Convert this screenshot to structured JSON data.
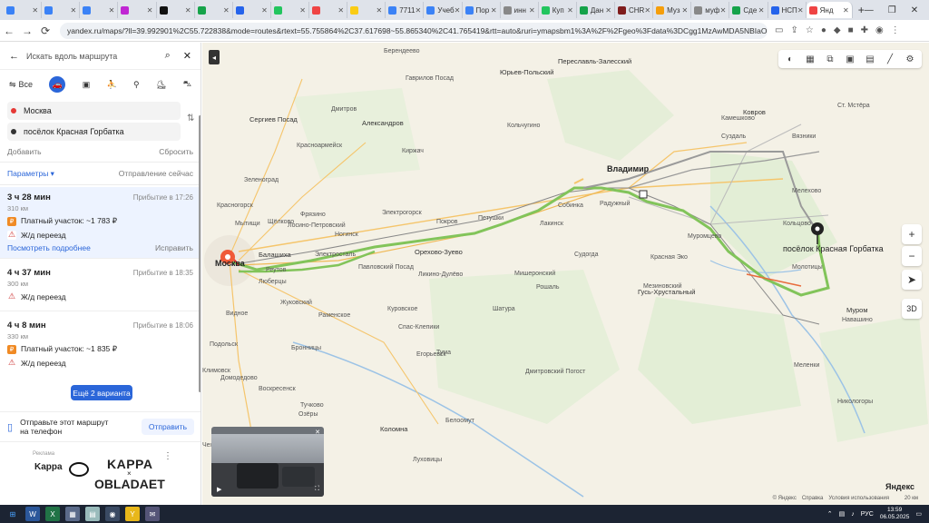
{
  "browser": {
    "tabs": [
      {
        "label": "",
        "color": "#3b82f6"
      },
      {
        "label": "",
        "color": "#3b82f6"
      },
      {
        "label": "",
        "color": "#3b82f6"
      },
      {
        "label": "",
        "color": "#c026d3"
      },
      {
        "label": "",
        "color": "#111111"
      },
      {
        "label": "",
        "color": "#16a34a"
      },
      {
        "label": "",
        "color": "#2563eb"
      },
      {
        "label": "",
        "color": "#22c55e"
      },
      {
        "label": "",
        "color": "#ef4444"
      },
      {
        "label": "",
        "color": "#facc15"
      },
      {
        "label": "7711",
        "color": "#3b82f6"
      },
      {
        "label": "Учеб",
        "color": "#3b82f6"
      },
      {
        "label": "Пор",
        "color": "#3b82f6"
      },
      {
        "label": "инн",
        "color": "#888888"
      },
      {
        "label": "Куп",
        "color": "#22c55e"
      },
      {
        "label": "Дан",
        "color": "#16a34a"
      },
      {
        "label": "CHR",
        "color": "#7f1d1d"
      },
      {
        "label": "Муз",
        "color": "#f59e0b"
      },
      {
        "label": "муф",
        "color": "#888888"
      },
      {
        "label": "Сде",
        "color": "#16a34a"
      },
      {
        "label": "НСП",
        "color": "#2563eb"
      },
      {
        "label": "Янд",
        "color": "#ef4444",
        "active": true
      }
    ],
    "url": "yandex.ru/maps/?ll=39.992901%2C55.722838&mode=routes&rtext=55.755864%2C37.617698~55.865340%2C41.765419&rtt=auto&ruri=ymapsbm1%3A%2F%2Fgeo%3Fdata%3DCgg1MzAwMDA5NBIaOKDQvtGB0YHQuNGPLC..."
  },
  "panel": {
    "search_placeholder": "Искать вдоль маршрута",
    "modes": [
      "Все"
    ],
    "from": "Москва",
    "to": "посёлок Красная Горбатка",
    "add": "Добавить",
    "reset": "Сбросить",
    "params": "Параметры ▾",
    "departure": "Отправление сейчас",
    "routes": [
      {
        "time": "3 ч 28 мин",
        "arrival": "Прибытие в 17:26",
        "distance": "310 км",
        "toll": "Платный участок: ~1 783 ₽",
        "rail": "Ж/д переезд",
        "details": "Посмотреть подробнее",
        "fix": "Исправить"
      },
      {
        "time": "4 ч 37 мин",
        "arrival": "Прибытие в 18:35",
        "distance": "300 км",
        "rail": "Ж/д переезд"
      },
      {
        "time": "4 ч 8 мин",
        "arrival": "Прибытие в 18:06",
        "distance": "330 км",
        "toll": "Платный участок: ~1 835 ₽",
        "rail": "Ж/д переезд"
      }
    ],
    "more_button": "Ещё 2 варианта",
    "send_text_1": "Отправьте этот маршрут",
    "send_text_2": "на телефон",
    "send_button": "Отправить",
    "ad": {
      "small": "Реклама",
      "brand1": "Kappa",
      "brand2": "KAPPA",
      "x": "×",
      "brand3": "OBLADAET"
    }
  },
  "map": {
    "labels": [
      {
        "t": "Берендеево",
        "c": "small"
      },
      {
        "t": "Переславль-Залесский",
        "c": "city"
      },
      {
        "t": "Юрьев-Польский",
        "c": "city"
      },
      {
        "t": "Гаврилов Посад",
        "c": "small"
      },
      {
        "t": "Сергиев Посад",
        "c": "city"
      },
      {
        "t": "Александров",
        "c": "city"
      },
      {
        "t": "Киржач",
        "c": "small"
      },
      {
        "t": "Владимир",
        "c": "big"
      },
      {
        "t": "Ковров",
        "c": "city"
      },
      {
        "t": "Камешково",
        "c": "small"
      },
      {
        "t": "Суздаль",
        "c": "small"
      },
      {
        "t": "Собинка",
        "c": "small"
      },
      {
        "t": "Радужный",
        "c": "small"
      },
      {
        "t": "Покров",
        "c": "small"
      },
      {
        "t": "Петушки",
        "c": "small"
      },
      {
        "t": "Электрогорск",
        "c": "small"
      },
      {
        "t": "Орехово-Зуево",
        "c": "city"
      },
      {
        "t": "Ногинск",
        "c": "small"
      },
      {
        "t": "Электросталь",
        "c": "small"
      },
      {
        "t": "Щёлково",
        "c": "small"
      },
      {
        "t": "Мытищи",
        "c": "small"
      },
      {
        "t": "Балашиха",
        "c": "city"
      },
      {
        "t": "Реутов",
        "c": "small"
      },
      {
        "t": "Люберцы",
        "c": "small"
      },
      {
        "t": "Москва",
        "c": "big"
      },
      {
        "t": "Жуковский",
        "c": "small"
      },
      {
        "t": "Раменское",
        "c": "small"
      },
      {
        "t": "Павловский Посад",
        "c": "small"
      },
      {
        "t": "Куровское",
        "c": "small"
      },
      {
        "t": "Шатура",
        "c": "small"
      },
      {
        "t": "Рошаль",
        "c": "small"
      },
      {
        "t": "Гусь-Хрустальный",
        "c": "city"
      },
      {
        "t": "Муром",
        "c": "city"
      },
      {
        "t": "Коломна",
        "c": "city"
      },
      {
        "t": "Егорьевск",
        "c": "small"
      },
      {
        "t": "Луховицы",
        "c": "small"
      },
      {
        "t": "Бронницы",
        "c": "small"
      },
      {
        "t": "Подольск",
        "c": "small"
      },
      {
        "t": "Красногорск",
        "c": "small"
      },
      {
        "t": "Зеленоград",
        "c": "small"
      },
      {
        "t": "Дмитров",
        "c": "small"
      },
      {
        "t": "Красноармейск",
        "c": "small"
      },
      {
        "t": "Фрязино",
        "c": "small"
      },
      {
        "t": "Лосино-Петровский",
        "c": "small"
      },
      {
        "t": "Кольчугино",
        "c": "small"
      },
      {
        "t": "Лакинск",
        "c": "small"
      },
      {
        "t": "Судогда",
        "c": "small"
      },
      {
        "t": "Муромцево",
        "c": "small"
      },
      {
        "t": "Мелехово",
        "c": "small"
      },
      {
        "t": "Вязники",
        "c": "small"
      },
      {
        "t": "Красная Эко",
        "c": "small"
      },
      {
        "t": "Мезиновский",
        "c": "small"
      },
      {
        "t": "Ст. Мстёра",
        "c": "small"
      },
      {
        "t": "Видное",
        "c": "small"
      },
      {
        "t": "Домодедово",
        "c": "small"
      },
      {
        "t": "Воскресенск",
        "c": "small"
      },
      {
        "t": "Белоомут",
        "c": "small"
      },
      {
        "t": "Озёры",
        "c": "small"
      },
      {
        "t": "Навашино",
        "c": "small"
      },
      {
        "t": "Меленки",
        "c": "small"
      },
      {
        "t": "Климовск",
        "c": "small"
      },
      {
        "t": "Чехов",
        "c": "small"
      },
      {
        "t": "Молотицы",
        "c": "small"
      },
      {
        "t": "Кольцово",
        "c": "small"
      },
      {
        "t": "Никологоры",
        "c": "small"
      },
      {
        "t": "Ликино-Дулёво",
        "c": "small"
      },
      {
        "t": "Тучково",
        "c": "small"
      },
      {
        "t": "Мишеронский",
        "c": "small"
      },
      {
        "t": "Дмитровский Погост",
        "c": "small"
      },
      {
        "t": "Тума",
        "c": "small"
      },
      {
        "t": "Спас-Клепики",
        "c": "small"
      }
    ],
    "destination": "посёлок Красная Горбатка",
    "yandex": "Яндекс",
    "legal": [
      "© Яндекс",
      "Справка",
      "Условия использования"
    ],
    "scale": "20 км"
  },
  "taskbar": {
    "lang": "РУС",
    "time": "13:59",
    "date": "06.05.2025"
  }
}
